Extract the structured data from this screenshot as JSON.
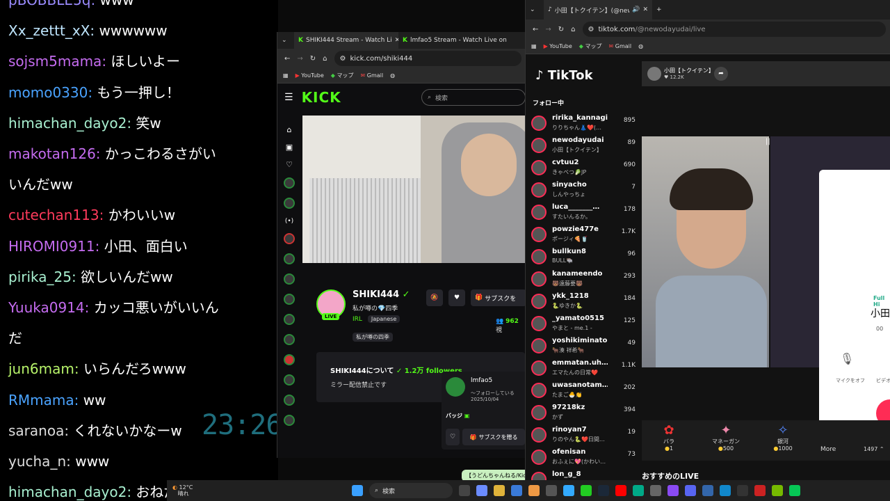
{
  "chat": [
    {
      "user": "pBOBBLE5q:",
      "text": "www",
      "color": "#9b8cff"
    },
    {
      "user": "Xx_zettt_xX:",
      "text": "wwwwww",
      "color": "#bfe6ff"
    },
    {
      "user": "sojsm5mama:",
      "text": "ほしいよー",
      "color": "#c56cf0"
    },
    {
      "user": "momo0330:",
      "text": "もう一押し！",
      "color": "#4aa3ff"
    },
    {
      "user": "himachan_dayo2:",
      "text": "笑w",
      "color": "#a8f0d0"
    },
    {
      "user": "makotan126:",
      "text": "かっこわるさがい",
      "color": "#c56cf0"
    },
    {
      "user": "",
      "text": "いんだww",
      "color": "#ffffff"
    },
    {
      "user": "cutechan113:",
      "text": "かわいいw",
      "color": "#ff3b5c"
    },
    {
      "user": "HIROMI0911:",
      "text": "小田、面白い",
      "color": "#c56cf0"
    },
    {
      "user": "pirika_25:",
      "text": "欲しいんだww",
      "color": "#a8f0d0"
    },
    {
      "user": "Yuuka0914:",
      "text": "カッコ悪いがいいん",
      "color": "#c56cf0"
    },
    {
      "user": "",
      "text": "だ",
      "color": "#ffffff"
    },
    {
      "user": "jun6mam:",
      "text": "いらんだろwww",
      "color": "#b7f36a"
    },
    {
      "user": "RMmama:",
      "text": "ww",
      "color": "#4aa3ff"
    },
    {
      "user": "saranoa:",
      "text": "くれないかなーw",
      "color": "#dddddd"
    },
    {
      "user": "yucha_n:",
      "text": "www",
      "color": "#dddddd"
    },
    {
      "user": "himachan_dayo2:",
      "text": "おねだり",
      "color": "#a8f0d0"
    }
  ],
  "clock": "23:26",
  "kick": {
    "tab1": "SHIKI444 Stream - Watch Li",
    "tab2": "lmfao5 Stream - Watch Live on",
    "url": "kick.com/shiki444",
    "bookmarks": [
      "YouTube",
      "マップ",
      "Gmail"
    ],
    "logo": "KICK",
    "search_placeholder": "検索",
    "streamer": "SHIKI444",
    "subtitle": "私が噂の💎四季",
    "category": "IRL",
    "tag_lang": "Japanese",
    "tag2": "私が噂の四季",
    "live": "LIVE",
    "sub_btn": "サブスクを",
    "viewers": "962",
    "viewers_suffix": "視",
    "about": "SHIKI444について",
    "followers": "1.2万 followers",
    "no_mirror": "ミラー配信禁止です",
    "popup_user": "lmfao5",
    "popup_follow": "～フォローしている",
    "popup_date": "2025/10/04",
    "popup_badge": "バッジ",
    "popup_sub": "サブスクを贈る",
    "toast": "【うどんちゃんねる/Kick】"
  },
  "tiktok": {
    "tab": "小田【トクイテン】(@newoday",
    "url_host": "tiktok.com",
    "url_path": "/@newodayudai/live",
    "bookmarks": [
      "YouTube",
      "マップ",
      "Gmail"
    ],
    "logo": "TikTok",
    "following": "フォロー中",
    "host_name": "小田【トクイテン】",
    "host_likes": "12.2K",
    "follows": [
      {
        "n": "ririka_kannagi",
        "s": "りりちゃん👗❤️(…",
        "c": "895"
      },
      {
        "n": "newodayudai",
        "s": "小田【トクイテン】",
        "c": "89"
      },
      {
        "n": "cvtuu2",
        "s": "きゃべつ🥬JP",
        "c": "690"
      },
      {
        "n": "sinyacho",
        "s": "しんやっちょ",
        "c": "7"
      },
      {
        "n": "luca_______…",
        "s": "すたいんるか。",
        "c": "178"
      },
      {
        "n": "powzie477e",
        "s": "ポージィ🍕🥤",
        "c": "1.7K"
      },
      {
        "n": "bullkun8",
        "s": "BULL🐃",
        "c": "96"
      },
      {
        "n": "kanameendo",
        "s": "🐻遠藤要🐻",
        "c": "293"
      },
      {
        "n": "ykk_1218",
        "s": "🐍ゆきか🐍",
        "c": "184"
      },
      {
        "n": "_yamato0515",
        "s": "やまと - me.1 -",
        "c": "125"
      },
      {
        "n": "yoshikiminato",
        "s": "🐂湊 祥希🐂",
        "c": "49"
      },
      {
        "n": "emmatan.uh…",
        "s": "エマたんの日常❤️",
        "c": "1.1K"
      },
      {
        "n": "uwasanotam…",
        "s": "たまご🐣👏",
        "c": "202"
      },
      {
        "n": "97218kz",
        "s": "かず",
        "c": "394"
      },
      {
        "n": "rinoyan7",
        "s": "りのやん🐍❤️日間…",
        "c": "19"
      },
      {
        "n": "ofenisan",
        "s": "おふぇに💖(かわい…",
        "c": "73"
      },
      {
        "n": "lon_g_8",
        "s": "",
        "c": ""
      }
    ],
    "gifts": [
      {
        "name": "バラ",
        "cost": "1"
      },
      {
        "name": "マネーガン",
        "cost": "500"
      },
      {
        "name": "銀河",
        "cost": "1000"
      }
    ],
    "more": "More",
    "coins": "1497",
    "recommended": "おすすめのLIVE",
    "call_label": "Full Hi",
    "call_name": "小田",
    "call_sub": "00",
    "mic_off": "マイクをオフ",
    "video_label": "ビデオ"
  },
  "taskbar": {
    "temp": "12°C",
    "weather": "晴れ",
    "search": "検索"
  }
}
